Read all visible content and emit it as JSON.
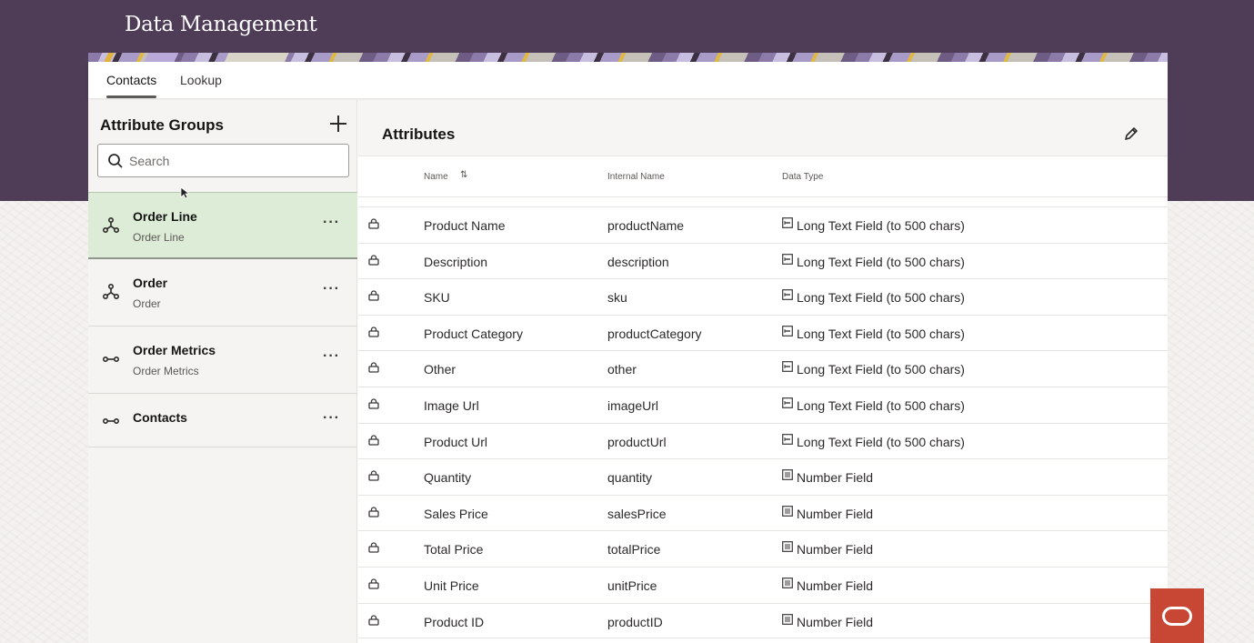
{
  "app": {
    "title": "Data Management"
  },
  "tabs": [
    {
      "label": "Contacts",
      "active": true
    },
    {
      "label": "Lookup",
      "active": false
    }
  ],
  "left_panel": {
    "title": "Attribute Groups",
    "add_icon": "plus-icon",
    "search": {
      "placeholder": "Search",
      "value": ""
    },
    "groups": [
      {
        "name": "Order Line",
        "subtitle": "Order Line",
        "icon": "hierarchy-icon",
        "selected": true
      },
      {
        "name": "Order",
        "subtitle": "Order",
        "icon": "hierarchy-icon",
        "selected": false
      },
      {
        "name": "Order Metrics",
        "subtitle": "Order Metrics",
        "icon": "link-icon",
        "selected": false
      },
      {
        "name": "Contacts",
        "subtitle": "",
        "icon": "link-icon",
        "selected": false
      }
    ],
    "more_label": "···"
  },
  "right_panel": {
    "title": "Attributes",
    "edit_icon": "pencil-icon",
    "columns": {
      "name": "Name",
      "sort_icon": "⇅",
      "internal_name": "Internal Name",
      "data_type": "Data Type"
    },
    "rows": [
      {
        "name": "Product Name",
        "internal": "productName",
        "type": "Long Text Field (to 500 chars)",
        "type_icon": "text-field-icon"
      },
      {
        "name": "Description",
        "internal": "description",
        "type": "Long Text Field (to 500 chars)",
        "type_icon": "text-field-icon"
      },
      {
        "name": "SKU",
        "internal": "sku",
        "type": "Long Text Field (to 500 chars)",
        "type_icon": "text-field-icon"
      },
      {
        "name": "Product Category",
        "internal": "productCategory",
        "type": "Long Text Field (to 500 chars)",
        "type_icon": "text-field-icon"
      },
      {
        "name": "Other",
        "internal": "other",
        "type": "Long Text Field (to 500 chars)",
        "type_icon": "text-field-icon"
      },
      {
        "name": "Image Url",
        "internal": "imageUrl",
        "type": "Long Text Field (to 500 chars)",
        "type_icon": "text-field-icon"
      },
      {
        "name": "Product Url",
        "internal": "productUrl",
        "type": "Long Text Field (to 500 chars)",
        "type_icon": "text-field-icon"
      },
      {
        "name": "Quantity",
        "internal": "quantity",
        "type": "Number Field",
        "type_icon": "number-field-icon"
      },
      {
        "name": "Sales Price",
        "internal": "salesPrice",
        "type": "Number Field",
        "type_icon": "number-field-icon"
      },
      {
        "name": "Total Price",
        "internal": "totalPrice",
        "type": "Number Field",
        "type_icon": "number-field-icon"
      },
      {
        "name": "Unit Price",
        "internal": "unitPrice",
        "type": "Number Field",
        "type_icon": "number-field-icon"
      },
      {
        "name": "Product ID",
        "internal": "productID",
        "type": "Number Field",
        "type_icon": "number-field-icon"
      }
    ]
  },
  "colors": {
    "header": "#4f3c57",
    "selected_group": "#dcecd7",
    "oracle_red": "#c74634"
  }
}
